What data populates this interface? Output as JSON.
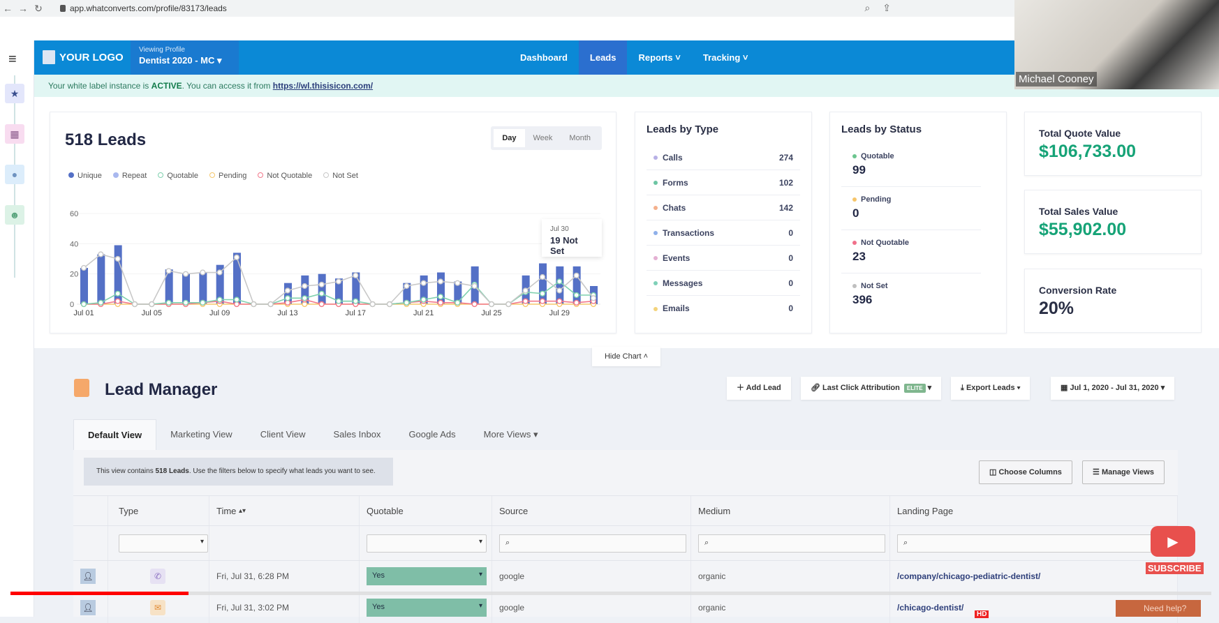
{
  "browser": {
    "url": "app.whatconverts.com/profile/83173/leads"
  },
  "video_overlay": {
    "participant_name": "Michael Cooney",
    "subscribe_label": "SUBSCRIBE",
    "hd_badge": "HD",
    "need_help": "Need help?",
    "progress_fraction": 0.148
  },
  "topnav": {
    "logo_text": "YOUR LOGO",
    "profile_label": "Viewing Profile",
    "profile_value": "Dentist 2020 - MC",
    "menu": [
      {
        "label": "Dashboard",
        "active": false
      },
      {
        "label": "Leads",
        "active": true
      },
      {
        "label": "Reports",
        "dropdown": true
      },
      {
        "label": "Tracking",
        "dropdown": true
      }
    ]
  },
  "notice": {
    "prefix": "Your white label instance is ",
    "status": "ACTIVE",
    "middle": ". You can access it from ",
    "link": "https://wl.thisisicon.com/"
  },
  "chart_card": {
    "title": "518 Leads",
    "range_options": [
      "Day",
      "Week",
      "Month"
    ],
    "range_selected": "Day",
    "tooltip": {
      "date": "Jul 30",
      "value": "19 Not Set"
    }
  },
  "chart_data": {
    "type": "bar",
    "title": "518 Leads",
    "xlabel": "",
    "ylabel": "",
    "ylim": [
      0,
      60
    ],
    "yticks": [
      0,
      20,
      40,
      60
    ],
    "legend_position": "top-left",
    "x": [
      "Jul 01",
      "Jul 02",
      "Jul 03",
      "Jul 04",
      "Jul 05",
      "Jul 06",
      "Jul 07",
      "Jul 08",
      "Jul 09",
      "Jul 10",
      "Jul 11",
      "Jul 12",
      "Jul 13",
      "Jul 14",
      "Jul 15",
      "Jul 16",
      "Jul 17",
      "Jul 18",
      "Jul 19",
      "Jul 20",
      "Jul 21",
      "Jul 22",
      "Jul 23",
      "Jul 24",
      "Jul 25",
      "Jul 26",
      "Jul 27",
      "Jul 28",
      "Jul 29",
      "Jul 30",
      "Jul 31"
    ],
    "xtick_labels": [
      "Jul 01",
      "Jul 05",
      "Jul 09",
      "Jul 13",
      "Jul 17",
      "Jul 21",
      "Jul 25",
      "Jul 29"
    ],
    "series": [
      {
        "name": "Unique",
        "kind": "bar",
        "color": "#5470c6",
        "values": [
          24,
          33,
          39,
          0,
          0,
          23,
          20,
          21,
          26,
          34,
          0,
          0,
          14,
          19,
          20,
          17,
          21,
          0,
          0,
          14,
          19,
          21,
          15,
          25,
          0,
          0,
          19,
          27,
          25,
          25,
          12
        ]
      },
      {
        "name": "Repeat",
        "kind": "bar",
        "color": "#a9b8ef",
        "values": [
          0,
          0,
          0,
          0,
          0,
          0,
          0,
          0,
          0,
          0,
          0,
          0,
          0,
          0,
          0,
          0,
          0,
          0,
          0,
          0,
          0,
          0,
          0,
          0,
          0,
          0,
          0,
          0,
          0,
          0,
          0
        ]
      },
      {
        "name": "Quotable",
        "kind": "line",
        "color": "#7fd1ae",
        "values": [
          0,
          1,
          7,
          0,
          0,
          1,
          1,
          1,
          3,
          3,
          0,
          0,
          4,
          4,
          7,
          2,
          2,
          0,
          0,
          1,
          3,
          5,
          1,
          13,
          0,
          0,
          8,
          7,
          15,
          6,
          6
        ]
      },
      {
        "name": "Pending",
        "kind": "line",
        "color": "#f6c76a",
        "values": [
          0,
          0,
          0,
          0,
          0,
          0,
          0,
          0,
          0,
          0,
          0,
          0,
          0,
          0,
          0,
          0,
          0,
          0,
          0,
          0,
          0,
          0,
          0,
          0,
          0,
          0,
          0,
          0,
          0,
          0,
          0
        ]
      },
      {
        "name": "Not Quotable",
        "kind": "line",
        "color": "#f2778a",
        "values": [
          0,
          0,
          2,
          0,
          0,
          0,
          0,
          1,
          2,
          0,
          0,
          0,
          1,
          3,
          0,
          0,
          0,
          0,
          0,
          1,
          2,
          1,
          1,
          0,
          0,
          0,
          2,
          2,
          2,
          1,
          2
        ]
      },
      {
        "name": "Not Set",
        "kind": "line",
        "color": "#c8c8c8",
        "values": [
          24,
          33,
          30,
          0,
          0,
          22,
          20,
          21,
          21,
          31,
          0,
          0,
          9,
          12,
          13,
          15,
          19,
          0,
          0,
          12,
          14,
          15,
          14,
          12,
          0,
          0,
          9,
          18,
          9,
          19,
          4
        ]
      }
    ]
  },
  "leads_by_type": {
    "title": "Leads by Type",
    "rows": [
      {
        "label": "Calls",
        "value": "274",
        "color": "#b7b0e6"
      },
      {
        "label": "Forms",
        "value": "102",
        "color": "#6cc5a3"
      },
      {
        "label": "Chats",
        "value": "142",
        "color": "#f4b08c"
      },
      {
        "label": "Transactions",
        "value": "0",
        "color": "#8fb0ea"
      },
      {
        "label": "Events",
        "value": "0",
        "color": "#e4b0d3"
      },
      {
        "label": "Messages",
        "value": "0",
        "color": "#7fd0b8"
      },
      {
        "label": "Emails",
        "value": "0",
        "color": "#f3d37b"
      }
    ]
  },
  "leads_by_status": {
    "title": "Leads by Status",
    "rows": [
      {
        "label": "Quotable",
        "value": "99",
        "color": "#6cc58f"
      },
      {
        "label": "Pending",
        "value": "0",
        "color": "#f6c56a"
      },
      {
        "label": "Not Quotable",
        "value": "23",
        "color": "#f0708a"
      },
      {
        "label": "Not Set",
        "value": "396",
        "color": "#bfbfbf"
      }
    ]
  },
  "value_cards": [
    {
      "label": "Total Quote Value",
      "value": "$106,733.00",
      "color": "#16a377"
    },
    {
      "label": "Total Sales Value",
      "value": "$55,902.00",
      "color": "#16a377"
    },
    {
      "label": "Conversion Rate",
      "value": "20%",
      "color": "#222845"
    }
  ],
  "hide_chart_label": "Hide Chart",
  "lead_manager": {
    "title": "Lead Manager",
    "buttons": {
      "add_lead": "Add Lead",
      "attribution": "Last Click Attribution",
      "elite_badge": "ELITE",
      "export": "Export Leads",
      "date_range": "Jul 1, 2020 - Jul 31, 2020"
    },
    "tabs": [
      "Default View",
      "Marketing View",
      "Client View",
      "Sales Inbox",
      "Google Ads",
      "More Views"
    ],
    "active_tab": "Default View",
    "info_prefix": "This view contains ",
    "info_count": "518 Leads",
    "info_suffix": ". Use the filters below to specify what leads you want to see.",
    "choose_columns": "Choose Columns",
    "manage_views": "Manage Views",
    "columns": [
      "",
      "Type",
      "Time",
      "Quotable",
      "Source",
      "Medium",
      "Landing Page"
    ],
    "rows": [
      {
        "type_icon": "phone-call-icon",
        "time": "Fri, Jul 31, 6:28 PM",
        "quotable": "Yes",
        "source": "google",
        "medium": "organic",
        "landing_page": "/company/chicago-pediatric-dentist/"
      },
      {
        "type_icon": "chat-icon",
        "time": "Fri, Jul 31, 3:02 PM",
        "quotable": "Yes",
        "source": "google",
        "medium": "organic",
        "landing_page": "/chicago-dentist/"
      }
    ]
  }
}
